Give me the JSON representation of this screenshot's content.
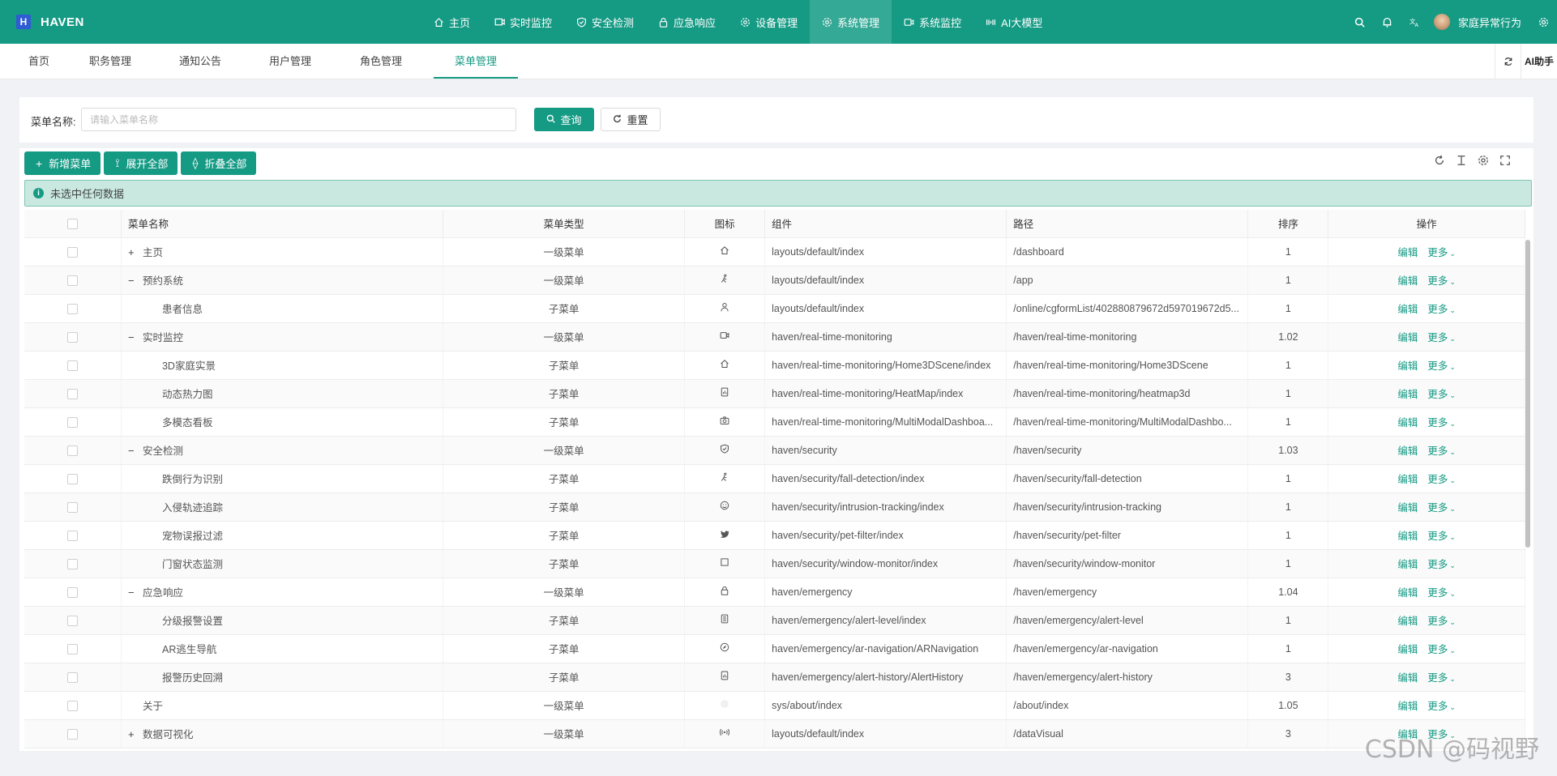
{
  "header": {
    "logo_letter": "H",
    "app_name": "HAVEN",
    "nav": [
      {
        "label": "主页",
        "icon": "home-icon"
      },
      {
        "label": "实时监控",
        "icon": "monitor-icon"
      },
      {
        "label": "安全检测",
        "icon": "shield-icon"
      },
      {
        "label": "应急响应",
        "icon": "lock-icon"
      },
      {
        "label": "设备管理",
        "icon": "gear-icon"
      },
      {
        "label": "系统管理",
        "icon": "gear-icon",
        "active": true
      },
      {
        "label": "系统监控",
        "icon": "video-icon"
      },
      {
        "label": "AI大模型",
        "icon": "ai-icon"
      }
    ],
    "username": "家庭异常行为"
  },
  "tabs": [
    {
      "label": "首页"
    },
    {
      "label": "职务管理"
    },
    {
      "label": "通知公告"
    },
    {
      "label": "用户管理"
    },
    {
      "label": "角色管理"
    },
    {
      "label": "菜单管理",
      "active": true
    }
  ],
  "tabs_right": {
    "ai_label": "AI助手"
  },
  "search": {
    "label": "菜单名称:",
    "placeholder": "请输入菜单名称",
    "query_label": "查询",
    "reset_label": "重置"
  },
  "toolbar": {
    "add_label": "新增菜单",
    "expand_label": "展开全部",
    "collapse_label": "折叠全部"
  },
  "alert": {
    "text": "未选中任何数据"
  },
  "table": {
    "columns": [
      "菜单名称",
      "菜单类型",
      "图标",
      "组件",
      "路径",
      "排序",
      "操作"
    ],
    "edit_label": "编辑",
    "more_label": "更多",
    "rows": [
      {
        "expander": "+",
        "level": 0,
        "name": "主页",
        "type": "一级菜单",
        "icon": "home-icon",
        "component": "layouts/default/index",
        "path": "/dashboard",
        "sort": "1"
      },
      {
        "expander": "−",
        "level": 0,
        "name": "预约系统",
        "type": "一级菜单",
        "icon": "walk-icon",
        "component": "layouts/default/index",
        "path": "/app",
        "sort": "1"
      },
      {
        "expander": "",
        "level": 1,
        "name": "患者信息",
        "type": "子菜单",
        "icon": "user-icon",
        "component": "layouts/default/index",
        "path": "/online/cgformList/402880879672d597019672d5...",
        "sort": "1"
      },
      {
        "expander": "−",
        "level": 0,
        "name": "实时监控",
        "type": "一级菜单",
        "icon": "video-icon",
        "component": "haven/real-time-monitoring",
        "path": "/haven/real-time-monitoring",
        "sort": "1.02"
      },
      {
        "expander": "",
        "level": 1,
        "name": "3D家庭实景",
        "type": "子菜单",
        "icon": "home-icon",
        "component": "haven/real-time-monitoring/Home3DScene/index",
        "path": "/haven/real-time-monitoring/Home3DScene",
        "sort": "1"
      },
      {
        "expander": "",
        "level": 1,
        "name": "动态热力图",
        "type": "子菜单",
        "icon": "report-icon",
        "component": "haven/real-time-monitoring/HeatMap/index",
        "path": "/haven/real-time-monitoring/heatmap3d",
        "sort": "1"
      },
      {
        "expander": "",
        "level": 1,
        "name": "多模态看板",
        "type": "子菜单",
        "icon": "camera-icon",
        "component": "haven/real-time-monitoring/MultiModalDashboa...",
        "path": "/haven/real-time-monitoring/MultiModalDashbo...",
        "sort": "1"
      },
      {
        "expander": "−",
        "level": 0,
        "name": "安全检测",
        "type": "一级菜单",
        "icon": "shield-icon",
        "component": "haven/security",
        "path": "/haven/security",
        "sort": "1.03"
      },
      {
        "expander": "",
        "level": 1,
        "name": "跌倒行为识别",
        "type": "子菜单",
        "icon": "walk-icon",
        "component": "haven/security/fall-detection/index",
        "path": "/haven/security/fall-detection",
        "sort": "1"
      },
      {
        "expander": "",
        "level": 1,
        "name": "入侵轨迹追踪",
        "type": "子菜单",
        "icon": "smile-icon",
        "component": "haven/security/intrusion-tracking/index",
        "path": "/haven/security/intrusion-tracking",
        "sort": "1"
      },
      {
        "expander": "",
        "level": 1,
        "name": "宠物误报过滤",
        "type": "子菜单",
        "icon": "bird-icon",
        "component": "haven/security/pet-filter/index",
        "path": "/haven/security/pet-filter",
        "sort": "1"
      },
      {
        "expander": "",
        "level": 1,
        "name": "门窗状态监测",
        "type": "子菜单",
        "icon": "square-icon",
        "component": "haven/security/window-monitor/index",
        "path": "/haven/security/window-monitor",
        "sort": "1"
      },
      {
        "expander": "−",
        "level": 0,
        "name": "应急响应",
        "type": "一级菜单",
        "icon": "lock-icon",
        "component": "haven/emergency",
        "path": "/haven/emergency",
        "sort": "1.04"
      },
      {
        "expander": "",
        "level": 1,
        "name": "分级报警设置",
        "type": "子菜单",
        "icon": "doc-icon",
        "component": "haven/emergency/alert-level/index",
        "path": "/haven/emergency/alert-level",
        "sort": "1"
      },
      {
        "expander": "",
        "level": 1,
        "name": "AR逃生导航",
        "type": "子菜单",
        "icon": "compass-icon",
        "component": "haven/emergency/ar-navigation/ARNavigation",
        "path": "/haven/emergency/ar-navigation",
        "sort": "1"
      },
      {
        "expander": "",
        "level": 1,
        "name": "报警历史回溯",
        "type": "子菜单",
        "icon": "report-icon",
        "component": "haven/emergency/alert-history/AlertHistory",
        "path": "/haven/emergency/alert-history",
        "sort": "3"
      },
      {
        "expander": "",
        "level": 0,
        "name": "关于",
        "type": "一级菜单",
        "icon": "blank-icon",
        "component": "sys/about/index",
        "path": "/about/index",
        "sort": "1.05"
      },
      {
        "expander": "+",
        "level": 0,
        "name": "数据可视化",
        "type": "一级菜单",
        "icon": "signal-icon",
        "component": "layouts/default/index",
        "path": "/dataVisual",
        "sort": "3"
      }
    ]
  },
  "watermark": "CSDN @码视野",
  "colors": {
    "primary": "#159a84",
    "nav_active": "#34a996",
    "alert_bg": "#c8e8e0"
  }
}
